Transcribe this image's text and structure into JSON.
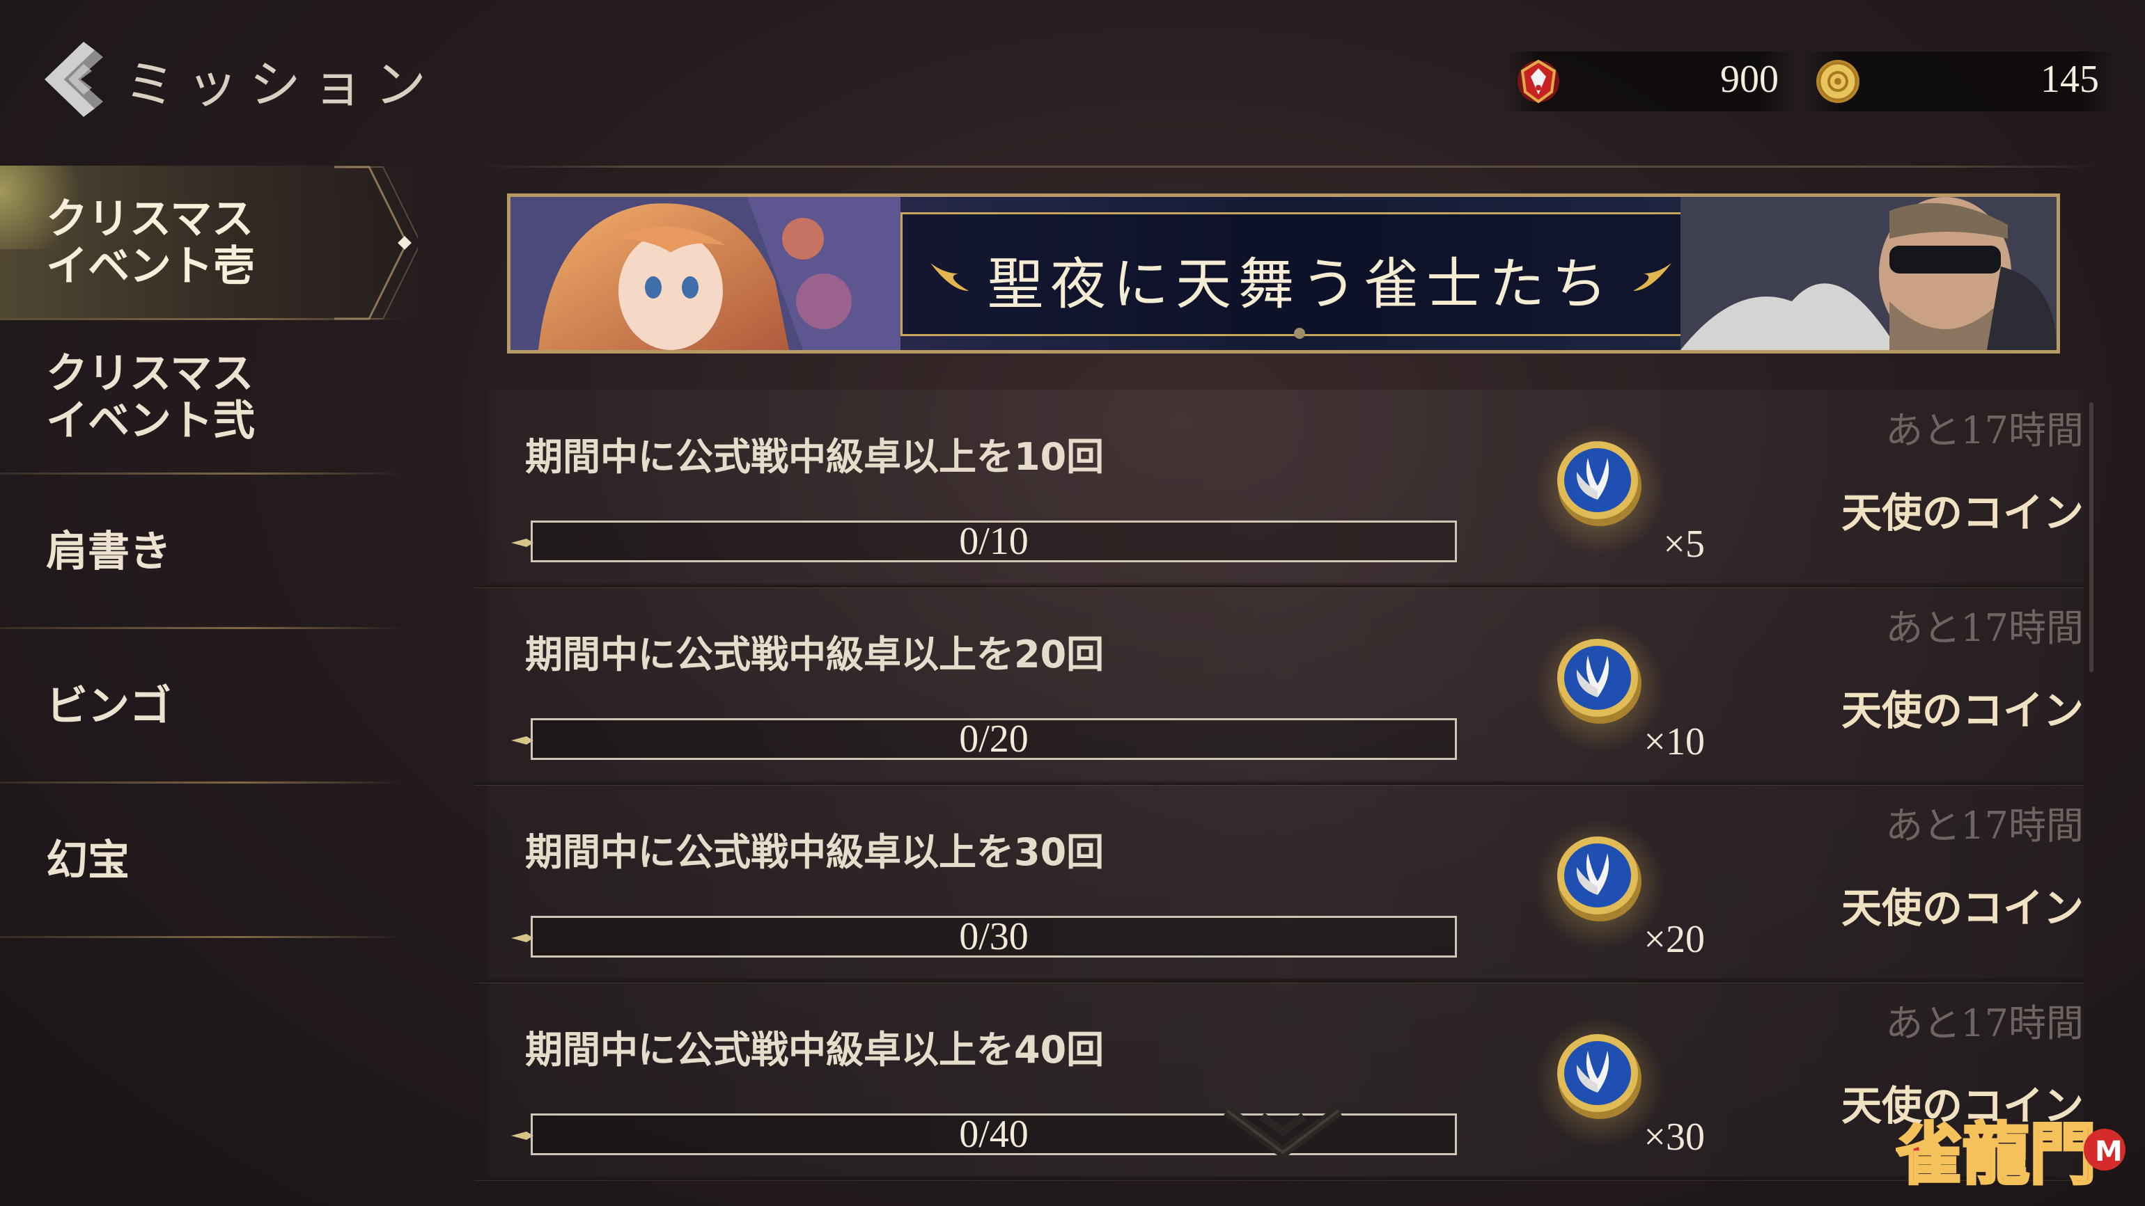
{
  "header": {
    "title": "ミッション",
    "currencies": [
      {
        "icon": "red-gem-icon",
        "value": "900"
      },
      {
        "icon": "gold-coin-icon",
        "value": "145"
      }
    ]
  },
  "sidebar": {
    "items": [
      {
        "label": "クリスマス\nイベント壱",
        "active": true
      },
      {
        "label": "クリスマス\nイベント弐",
        "active": false
      },
      {
        "label": "肩書き",
        "active": false
      },
      {
        "label": "ビンゴ",
        "active": false
      },
      {
        "label": "幻宝",
        "active": false
      }
    ]
  },
  "banner": {
    "title": "聖夜に天舞う雀士たち"
  },
  "missions": [
    {
      "text": "期間中に公式戦中級卓以上を10回",
      "progress": "0/10",
      "progress_fraction": 0,
      "remaining": "あと17時間",
      "reward_qty": "×5",
      "reward_name": "天使のコイン"
    },
    {
      "text": "期間中に公式戦中級卓以上を20回",
      "progress": "0/20",
      "progress_fraction": 0,
      "remaining": "あと17時間",
      "reward_qty": "×10",
      "reward_name": "天使のコイン"
    },
    {
      "text": "期間中に公式戦中級卓以上を30回",
      "progress": "0/30",
      "progress_fraction": 0,
      "remaining": "あと17時間",
      "reward_qty": "×20",
      "reward_name": "天使のコイン"
    },
    {
      "text": "期間中に公式戦中級卓以上を40回",
      "progress": "0/40",
      "progress_fraction": 0,
      "remaining": "あと17時間",
      "reward_qty": "×30",
      "reward_name": "天使のコイン"
    }
  ],
  "watermark": {
    "logo_text": "雀龍門",
    "badge_text": "M"
  },
  "colors": {
    "accent_gold": "#c6a865",
    "coin_blue": "#1f4fb0",
    "background": "#251c1e"
  }
}
